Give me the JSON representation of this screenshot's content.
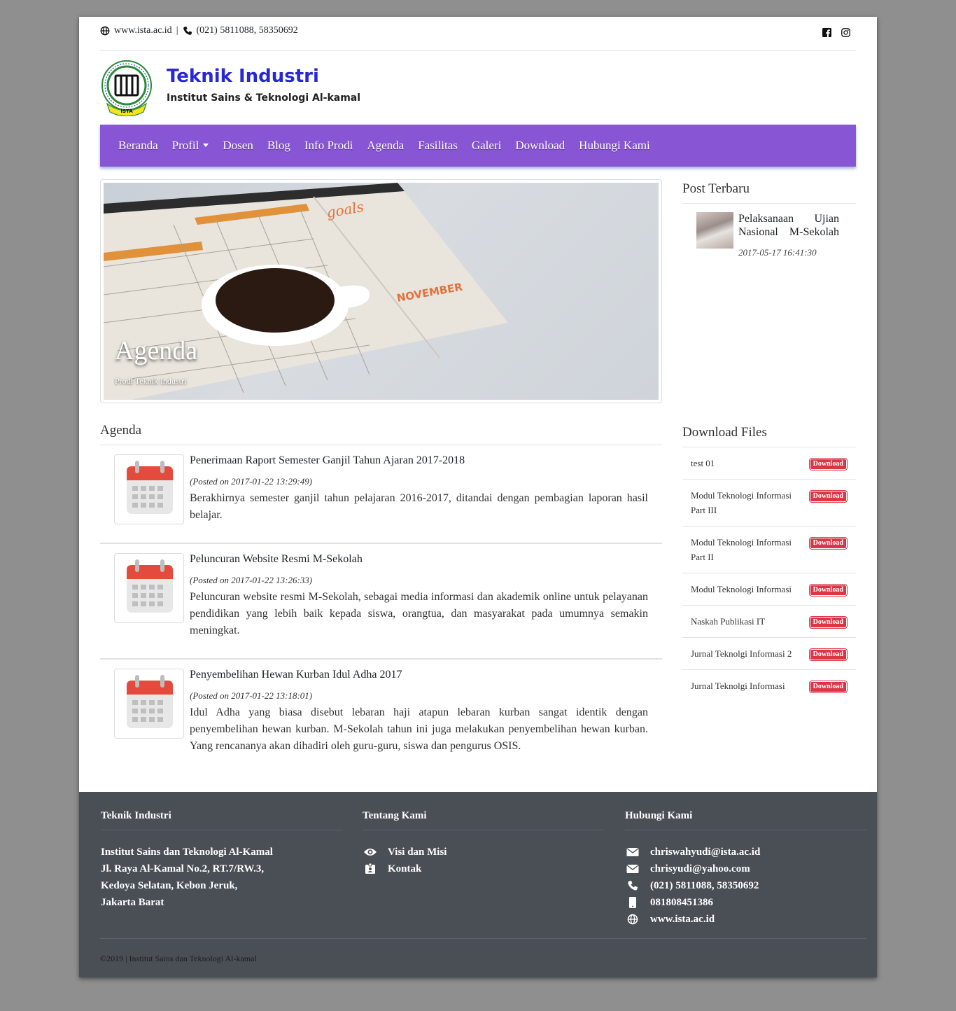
{
  "topbar": {
    "website": "www.ista.ac.id",
    "separator": "|",
    "phone": "(021) 5811088, 58350692"
  },
  "brand": {
    "title": "Teknik Industri",
    "subtitle": "Institut Sains & Teknologi Al-kamal",
    "logo_text": "ISTA"
  },
  "nav": {
    "items": [
      "Beranda",
      "Profil",
      "Dosen",
      "Blog",
      "Info Prodi",
      "Agenda",
      "Fasilitas",
      "Galeri",
      "Download",
      "Hubungi Kami"
    ]
  },
  "hero": {
    "title": "Agenda",
    "subtitle": "Prodi Teknik Industri"
  },
  "sidebar": {
    "post_heading": "Post Terbaru",
    "post": {
      "title": "Pelaksanaan Ujian Nasional M-Sekolah",
      "date": "2017-05-17 16:41:30"
    },
    "download_heading": "Download Files",
    "badge_label": "Download",
    "files": [
      "test 01",
      "Modul Teknologi Informasi Part III",
      "Modul Teknologi Informasi Part II",
      "Modul Teknologi Informasi",
      "Naskah Publikasi IT",
      "Jurnal Teknolgi Informasi 2",
      "Jurnal Teknolgi Informasi"
    ]
  },
  "agenda": {
    "heading": "Agenda",
    "items": [
      {
        "title": "Penerimaan Raport Semester Ganjil Tahun Ajaran 2017-2018",
        "date": "(Posted on 2017-01-22 13:29:49)",
        "desc": "Berakhirnya semester ganjil tahun pelajaran 2016-2017, ditandai dengan pembagian laporan hasil belajar."
      },
      {
        "title": "Peluncuran Website Resmi M-Sekolah",
        "date": "(Posted on 2017-01-22 13:26:33)",
        "desc": "Peluncuran website resmi M-Sekolah, sebagai media informasi dan akademik online untuk pelayanan pendidikan yang lebih baik kepada siswa, orangtua, dan masyarakat pada umumnya semakin meningkat."
      },
      {
        "title": "Penyembelihan Hewan Kurban Idul Adha 2017",
        "date": "(Posted on 2017-01-22 13:18:01)",
        "desc": "Idul Adha yang biasa disebut lebaran haji atapun lebaran kurban sangat identik dengan penyembelihan hewan kurban. M-Sekolah tahun ini juga melakukan penyembelihan hewan kurban. Yang rencananya akan dihadiri oleh guru-guru, siswa dan pengurus OSIS."
      }
    ]
  },
  "footer": {
    "col1": {
      "heading": "Teknik Industri",
      "lines": [
        "Institut Sains dan Teknologi Al-Kamal",
        "Jl. Raya Al-Kamal No.2, RT.7/RW.3,",
        "Kedoya Selatan, Kebon Jeruk,",
        "Jakarta Barat"
      ]
    },
    "col2": {
      "heading": "Tentang Kami",
      "links": [
        "Visi dan Misi",
        "Kontak"
      ]
    },
    "col3": {
      "heading": "Hubungi Kami",
      "email1": "chriswahyudi@ista.ac.id",
      "email2": "chrisyudi@yahoo.com",
      "phone": "(021) 5811088, 58350692",
      "mobile": "081808451386",
      "website": "www.ista.ac.id"
    },
    "copyright": "©2019 | Institut Sains dan Teknologi Al-kamal"
  },
  "colors": {
    "nav_bg": "#8856d4",
    "brand_title": "#2727d8",
    "footer_bg": "#4a4e55",
    "badge": "#dc3545",
    "page_bg": "#8f8f8f"
  }
}
